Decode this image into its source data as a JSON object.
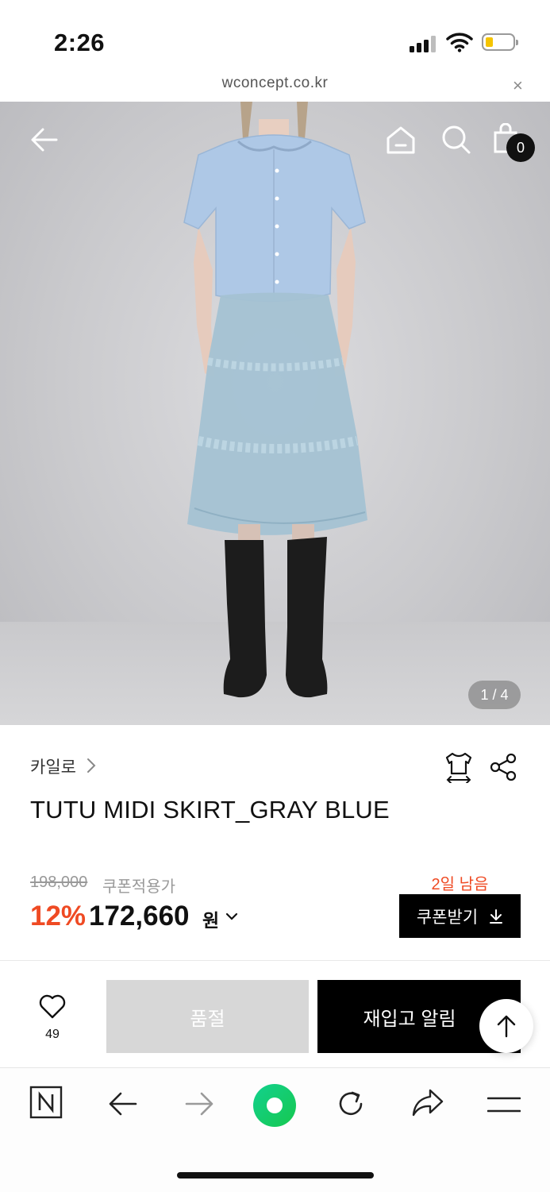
{
  "status_bar": {
    "time": "2:26"
  },
  "browser": {
    "url": "wconcept.co.kr",
    "close_glyph": "×"
  },
  "header_icons": [
    "back-arrow-icon",
    "home-icon",
    "search-icon",
    "shopping-bag-icon"
  ],
  "cart": {
    "count": "0"
  },
  "gallery": {
    "counter": "1 / 4"
  },
  "product": {
    "brand": "카일로",
    "title": "TUTU MIDI SKIRT_GRAY BLUE",
    "original_price": "198,000",
    "coupon_label": "쿠폰적용가",
    "discount": "12%",
    "price": "172,660",
    "currency": "원"
  },
  "coupon": {
    "days_left": "2일 남음",
    "button_label": "쿠폰받기"
  },
  "actions": {
    "like_count": "49",
    "soldout_label": "품절",
    "restock_label": "재입고 알림"
  },
  "bottom_toolbar": [
    "naver-icon",
    "back-icon",
    "forward-icon",
    "green-dot-icon",
    "reload-icon",
    "share-icon",
    "menu-icon"
  ],
  "colors": {
    "accent_orange": "#ef4a23",
    "black": "#000000",
    "soldout_gray": "#d7d7d7",
    "toolbar_green": "#19ce60"
  }
}
